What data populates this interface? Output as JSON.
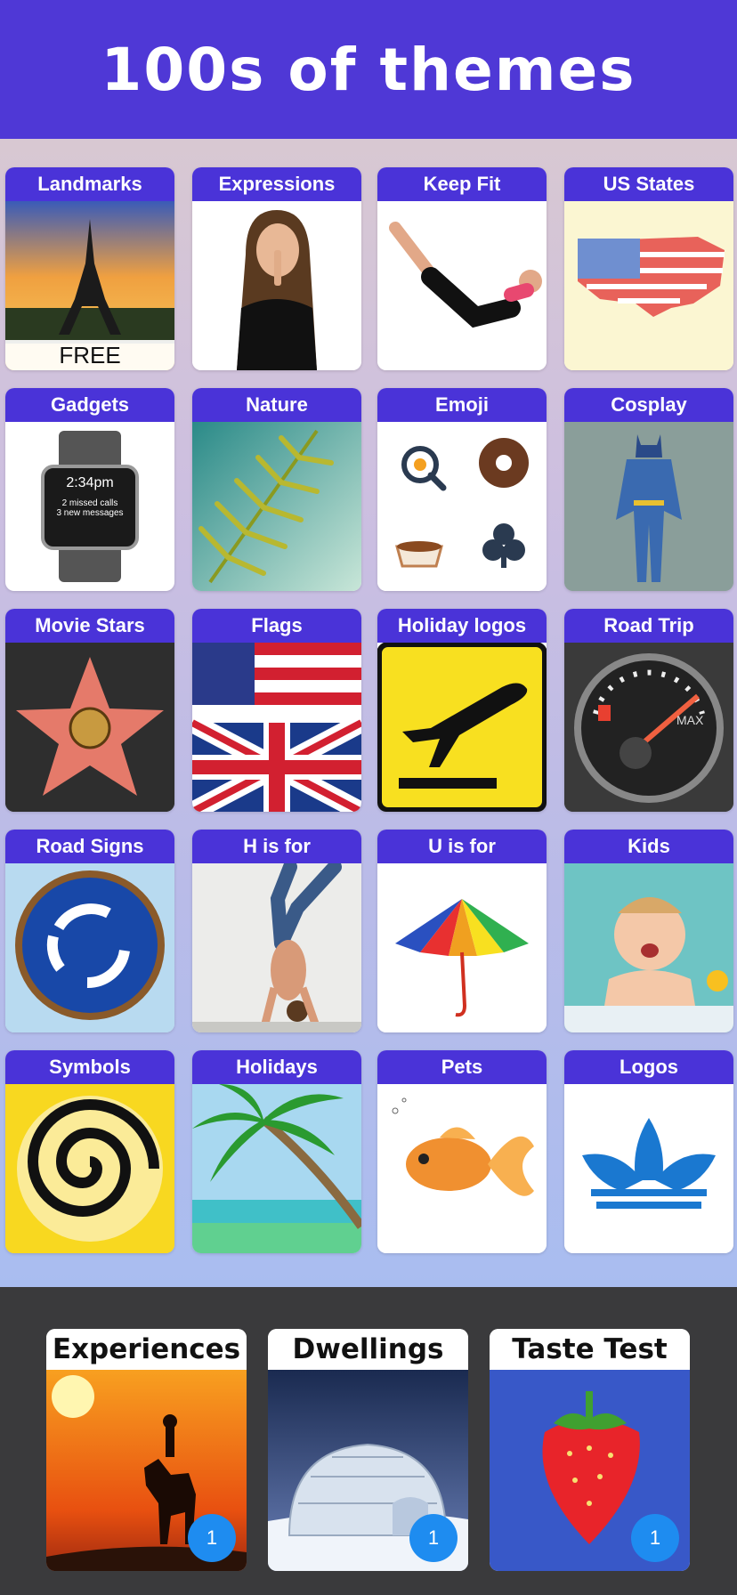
{
  "header": {
    "title": "100s of themes"
  },
  "themes": [
    {
      "label": "Landmarks",
      "icon": "eiffel-tower",
      "badge": "FREE"
    },
    {
      "label": "Expressions",
      "icon": "woman-shush"
    },
    {
      "label": "Keep Fit",
      "icon": "woman-exercise"
    },
    {
      "label": "US States",
      "icon": "usa-flag-map"
    },
    {
      "label": "Gadgets",
      "icon": "smartwatch",
      "watch_time": "2:34pm",
      "watch_msg1": "2 missed calls",
      "watch_msg2": "3 new messages"
    },
    {
      "label": "Nature",
      "icon": "fern"
    },
    {
      "label": "Emoji",
      "icon": "emoji-grid"
    },
    {
      "label": "Cosplay",
      "icon": "batman"
    },
    {
      "label": "Movie Stars",
      "icon": "walk-of-fame-star"
    },
    {
      "label": "Flags",
      "icon": "us-uk-flags"
    },
    {
      "label": "Holiday logos",
      "icon": "departures-sign"
    },
    {
      "label": "Road Trip",
      "icon": "fuel-gauge",
      "gauge_text": "MAX"
    },
    {
      "label": "Road Signs",
      "icon": "roundabout-sign"
    },
    {
      "label": "H is for",
      "icon": "handstand"
    },
    {
      "label": "U is for",
      "icon": "umbrella"
    },
    {
      "label": "Kids",
      "icon": "crying-baby"
    },
    {
      "label": "Symbols",
      "icon": "spiral"
    },
    {
      "label": "Holidays",
      "icon": "palm-tree"
    },
    {
      "label": "Pets",
      "icon": "goldfish"
    },
    {
      "label": "Logos",
      "icon": "trefoil-logo"
    }
  ],
  "bottom_themes": [
    {
      "label": "Experiences",
      "icon": "camel-desert",
      "count": "1"
    },
    {
      "label": "Dwellings",
      "icon": "igloo",
      "count": "1"
    },
    {
      "label": "Taste Test",
      "icon": "strawberry",
      "count": "1"
    }
  ],
  "colors": {
    "header_bg": "#4f38d6",
    "label_bg": "#4a33d8",
    "badge_bg": "#1e8cf0"
  }
}
